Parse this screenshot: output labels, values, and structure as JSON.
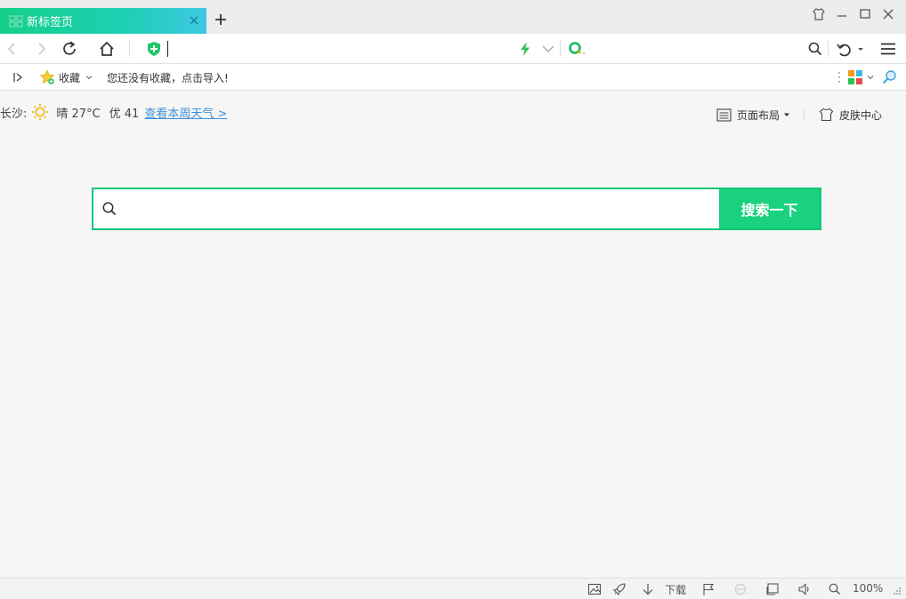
{
  "tab": {
    "title": "新标签页"
  },
  "bookmarks": {
    "favorites_label": "收藏",
    "empty_hint": "您还没有收藏，点击导入!"
  },
  "weather": {
    "city": "长沙:",
    "condition": "晴 27°C",
    "aqi": "优 41",
    "link": "查看本周天气 >"
  },
  "tools": {
    "layout_label": "页面布局",
    "skin_label": "皮肤中心"
  },
  "search": {
    "placeholder": "",
    "button_label": "搜索一下"
  },
  "status": {
    "download_label": "下载",
    "zoom": "100%"
  },
  "colors": {
    "accent": "#1ad17d",
    "tab_start": "#13d08a",
    "tab_end": "#3ec8e4",
    "link": "#3e8fd8"
  }
}
